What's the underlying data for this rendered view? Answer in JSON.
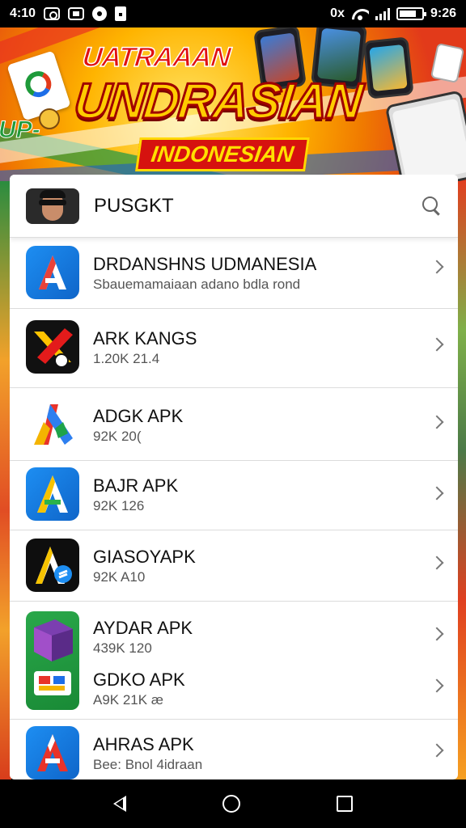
{
  "status_bar": {
    "time_left": "4:10",
    "time_right": "9:26",
    "right_text": "0x"
  },
  "banner": {
    "title_small": "UATRAAAN",
    "title_big": "UNDRASIAN",
    "subtitle": "INDONESIAN",
    "side_text": "UP-"
  },
  "search": {
    "value": "PUSGKT"
  },
  "apps": [
    {
      "title": "DRDANSHNS UDMANESIA",
      "subtitle": "Sbauemamaiaan adano bdla rond",
      "icon": "a-blue-icon"
    },
    {
      "title": "ARK KANGS",
      "subtitle": "1.20K 21.4",
      "icon": "x-app-icon"
    },
    {
      "title": "ADGK APK",
      "subtitle": "92K 20(",
      "icon": "g-app-icon"
    },
    {
      "title": "BAJR APK",
      "subtitle": "92K 126",
      "icon": "a-blue-icon"
    },
    {
      "title": "GIASOYAPK",
      "subtitle": "92K A10",
      "icon": "a-dark-icon"
    },
    {
      "title": "AYDAR APK",
      "subtitle": "439K 120",
      "icon": "cube-icon"
    },
    {
      "title": "GDKO APK",
      "subtitle": "A9K 21K æ",
      "icon": "cube-icon"
    },
    {
      "title": "AHRAS APK",
      "subtitle": "Bee: Bnol 4idraan",
      "icon": "a-blue-red-icon"
    }
  ],
  "colors": {
    "accent_blue": "#1d8ef2",
    "banner_red": "#d6120f",
    "banner_yellow": "#ffcc00"
  }
}
